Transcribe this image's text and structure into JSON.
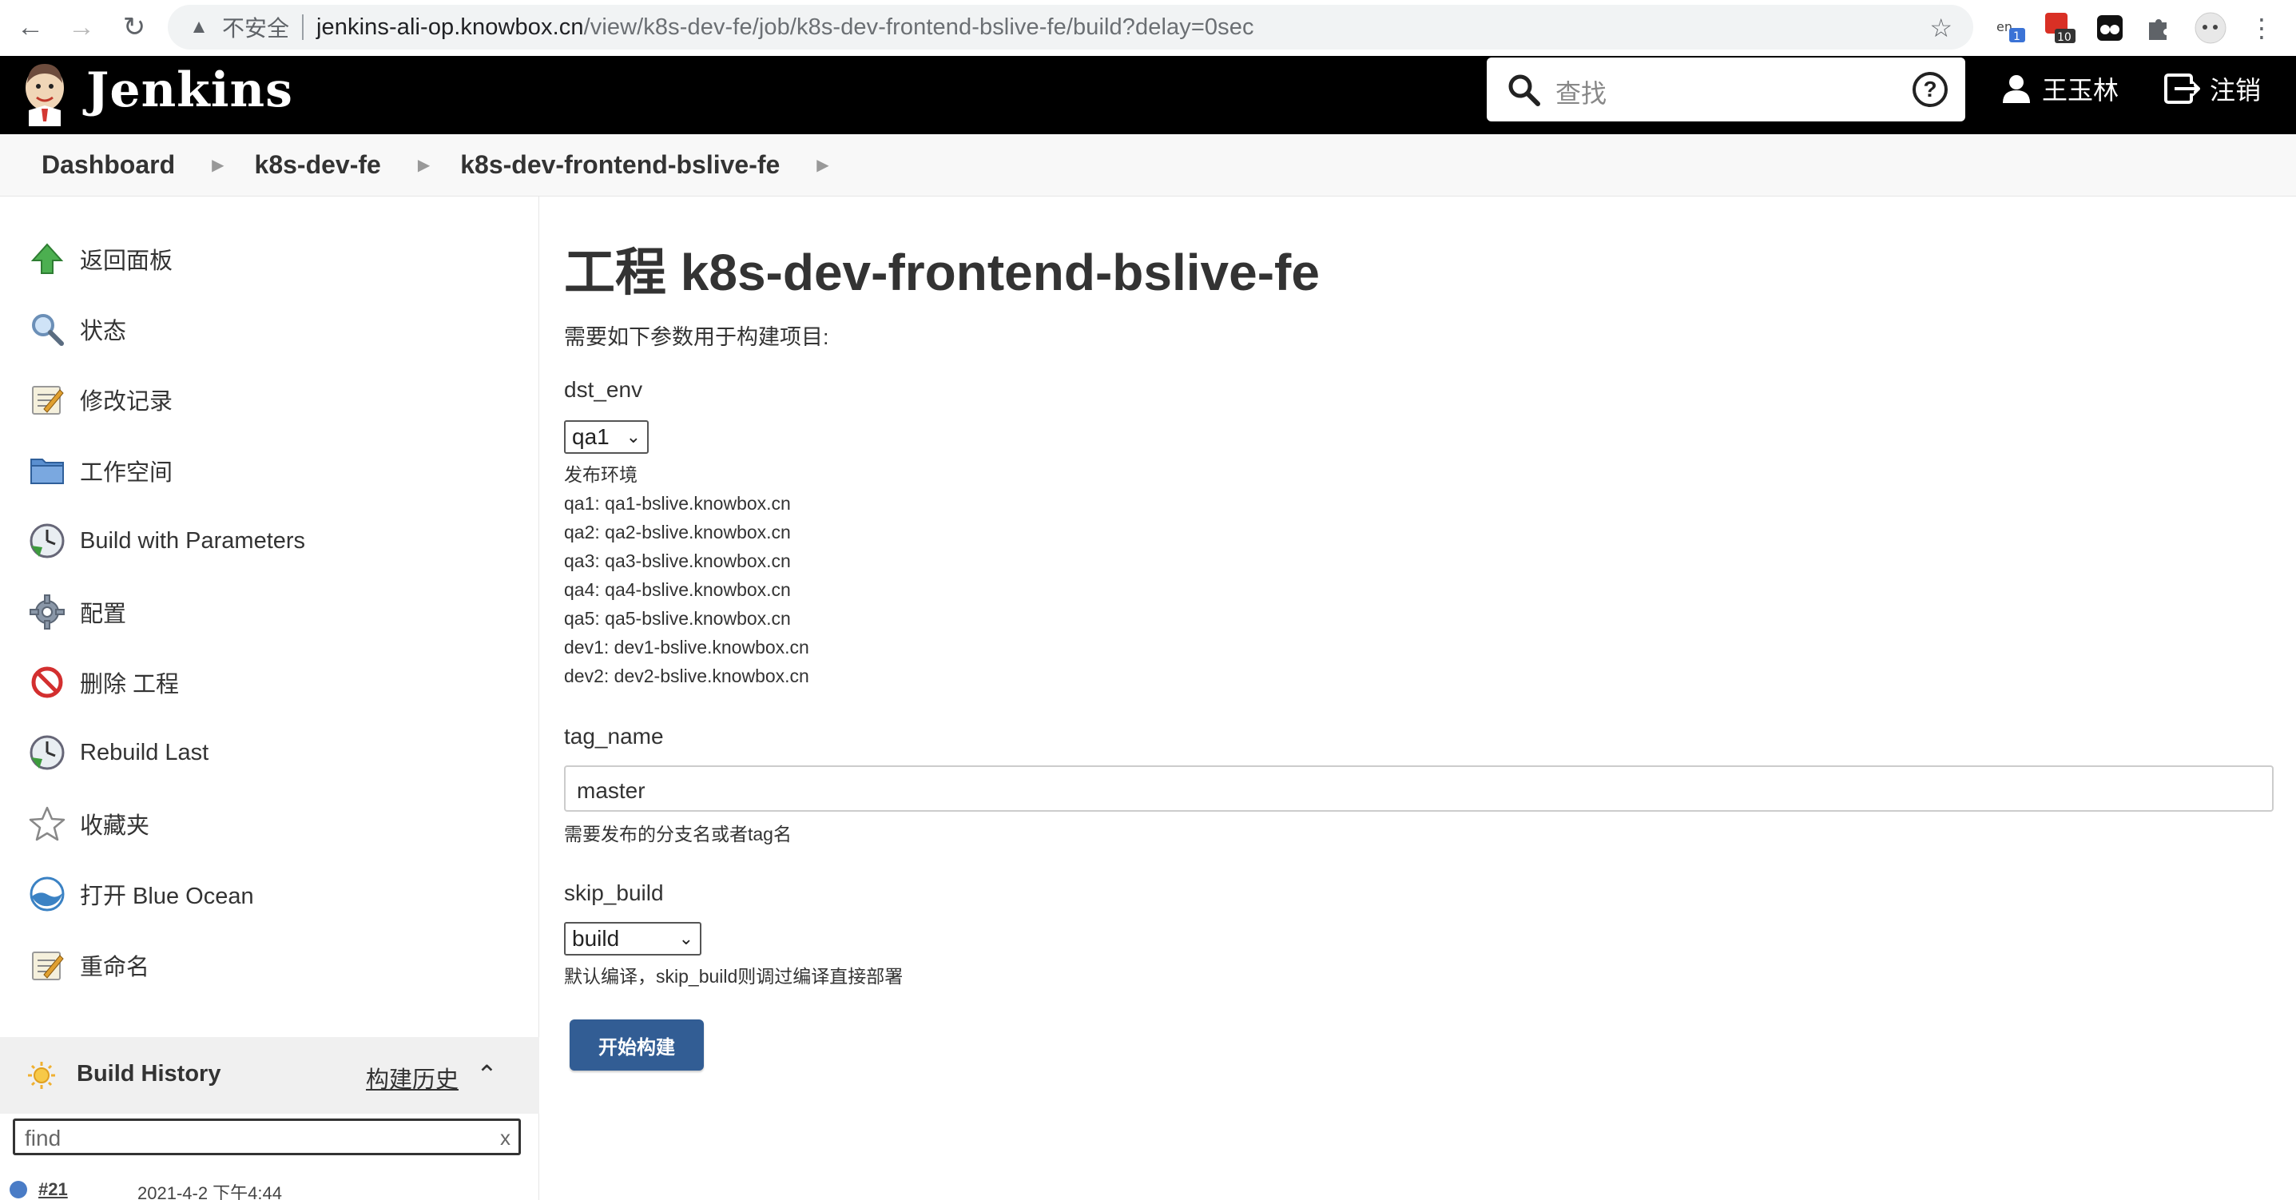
{
  "browser": {
    "security_label": "不安全",
    "url_host": "jenkins-ali-op.knowbox.cn",
    "url_path": "/view/k8s-dev-fe/job/k8s-dev-frontend-bslive-fe/build?delay=0sec",
    "ext_badges": [
      "1",
      "10"
    ]
  },
  "header": {
    "brand": "Jenkins",
    "search_placeholder": "查找",
    "help_symbol": "?",
    "user_name": "王玉林",
    "logout_label": "注销"
  },
  "breadcrumb": [
    "Dashboard",
    "k8s-dev-fe",
    "k8s-dev-frontend-bslive-fe"
  ],
  "sidebar": {
    "tasks": [
      {
        "label": "返回面板",
        "icon": "up-arrow-icon"
      },
      {
        "label": "状态",
        "icon": "search-icon"
      },
      {
        "label": "修改记录",
        "icon": "notepad-icon"
      },
      {
        "label": "工作空间",
        "icon": "folder-icon"
      },
      {
        "label": "Build with Parameters",
        "icon": "clock-icon"
      },
      {
        "label": "配置",
        "icon": "gear-icon"
      },
      {
        "label": "删除 工程",
        "icon": "no-entry-icon"
      },
      {
        "label": "Rebuild Last",
        "icon": "clock-icon"
      },
      {
        "label": "收藏夹",
        "icon": "star-icon"
      },
      {
        "label": "打开 Blue Ocean",
        "icon": "blue-ocean-icon"
      },
      {
        "label": "重命名",
        "icon": "notepad-icon"
      }
    ],
    "build_history": {
      "title": "Build History",
      "trend_link": "构建历史",
      "find_value": "find",
      "clear_label": "x",
      "first_build_number": "#21",
      "first_build_date": "2021-4-2 下午4:44"
    }
  },
  "main": {
    "title": "工程 k8s-dev-frontend-bslive-fe",
    "intro": "需要如下参数用于构建项目:",
    "params": {
      "dst_env": {
        "name": "dst_env",
        "selected": "qa1",
        "desc_title": "发布环境",
        "desc_lines": [
          "qa1: qa1-bslive.knowbox.cn",
          "qa2: qa2-bslive.knowbox.cn",
          "qa3: qa3-bslive.knowbox.cn",
          "qa4: qa4-bslive.knowbox.cn",
          "qa5: qa5-bslive.knowbox.cn",
          "dev1: dev1-bslive.knowbox.cn",
          "dev2: dev2-bslive.knowbox.cn"
        ]
      },
      "tag_name": {
        "name": "tag_name",
        "value": "master",
        "desc": "需要发布的分支名或者tag名"
      },
      "skip_build": {
        "name": "skip_build",
        "selected": "build",
        "desc": "默认编译，skip_build则调过编译直接部署"
      }
    },
    "submit_label": "开始构建"
  },
  "colors": {
    "header_bg": "#000000",
    "button_bg": "#325d94",
    "breadcrumb_bg": "#f8f8f8",
    "build_history_bg": "#f0f0f0"
  }
}
